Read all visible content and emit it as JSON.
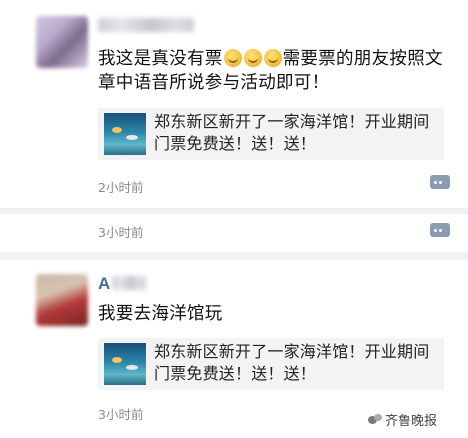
{
  "posts": [
    {
      "author": "",
      "message_part1": "我这是真没有票",
      "message_part2": "需要票的朋友按照文",
      "message_line2": "章中语音所说参与活动即可！",
      "link_title_line1": "郑东新区新开了一家海洋馆！开业期间",
      "link_title_line2": "门票免费送！送！送！",
      "time": "2小时前"
    },
    {
      "time": "3小时前"
    },
    {
      "author": "A",
      "message": "我要去海洋馆玩",
      "link_title_line1": "郑东新区新开了一家海洋馆！开业期间",
      "link_title_line2": "门票免费送！送！送！",
      "time": "3小时前"
    }
  ],
  "watermark": {
    "text": "齐鲁晚报"
  },
  "colors": {
    "author_name": "#4b6a9b",
    "timestamp": "#8c8c8c",
    "comment_button": "#8a9bb4",
    "link_card_bg": "#f3f3f5"
  },
  "icons": [
    "comment-icon",
    "wechat-icon"
  ]
}
